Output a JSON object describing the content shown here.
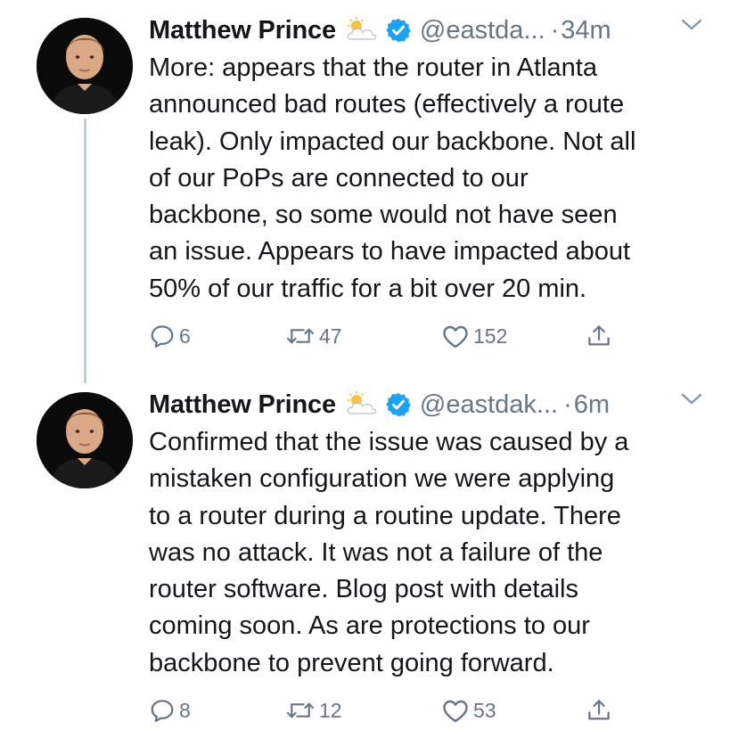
{
  "tweets": [
    {
      "author_name": "Matthew Prince",
      "author_emoji": "sun-behind-cloud",
      "handle": "@eastda...",
      "separator": "·",
      "time": "34m",
      "lines": [
        "More: appears that the router in Atlanta",
        "announced bad routes (effectively a route",
        "leak). Only impacted our backbone. Not all",
        "of our PoPs are connected to our",
        "backbone, so some would not have seen",
        "an issue. Appears to have impacted about",
        "50% of our traffic for a bit over 20 min."
      ],
      "replies": "6",
      "retweets": "47",
      "likes": "152"
    },
    {
      "author_name": "Matthew Prince",
      "author_emoji": "sun-behind-cloud",
      "handle": "@eastdak...",
      "separator": "·",
      "time": "6m",
      "lines": [
        "Confirmed that the issue was caused by a",
        "mistaken configuration we were applying",
        "to a router during a routine update. There",
        "was no attack. It was not a failure of the",
        "router software. Blog post with details",
        "coming soon. As are protections to our",
        "backbone to prevent going forward."
      ],
      "replies": "8",
      "retweets": "12",
      "likes": "53"
    }
  ],
  "colors": {
    "text": "#14171a",
    "muted": "#657786",
    "verified": "#1da1f2",
    "thread_line": "#c4cfd6"
  },
  "icons": [
    "sun-behind-cloud-icon",
    "verified-badge-icon",
    "chevron-down-icon",
    "reply-icon",
    "retweet-icon",
    "heart-icon",
    "share-icon"
  ]
}
